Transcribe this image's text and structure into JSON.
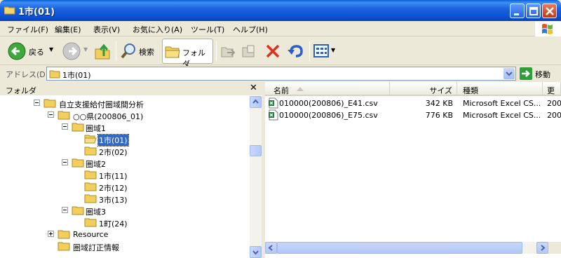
{
  "window": {
    "title": "1市(01)"
  },
  "menu": [
    "ファイル(F)",
    "編集(E)",
    "表示(V)",
    "お気に入り(A)",
    "ツール(T)",
    "ヘルプ(H)"
  ],
  "toolbar": {
    "back_label": "戻る",
    "search_label": "検索",
    "folders_label": "フォルダ"
  },
  "address": {
    "label": "アドレス(D)",
    "value": "1市(01)",
    "go_label": "移動"
  },
  "folder_pane": {
    "header": "フォルダ",
    "close_glyph": "✕",
    "tree": [
      {
        "label": "自立支援給付圏域間分析",
        "expander": "minus"
      },
      {
        "label": "○○県(200806_01)",
        "expander": "minus"
      },
      {
        "label": "圏域1",
        "expander": "minus"
      },
      {
        "label": "1市(01)",
        "expander": "none",
        "selected": true,
        "open": true
      },
      {
        "label": "2市(02)",
        "expander": "none"
      },
      {
        "label": "圏域2",
        "expander": "minus"
      },
      {
        "label": "1市(11)",
        "expander": "none"
      },
      {
        "label": "2市(12)",
        "expander": "none"
      },
      {
        "label": "3市(13)",
        "expander": "none"
      },
      {
        "label": "圏域3",
        "expander": "minus"
      },
      {
        "label": "1町(24)",
        "expander": "none"
      },
      {
        "label": "Resource",
        "expander": "plus"
      },
      {
        "label": "圏域訂正情報",
        "expander": "none"
      }
    ]
  },
  "file_list": {
    "columns": {
      "name": "名前",
      "size": "サイズ",
      "type": "種類",
      "modified": "更"
    },
    "rows": [
      {
        "name": "010000(200806)_E41.csv",
        "size": "342 KB",
        "type": "Microsoft Excel CS...",
        "modified": "200"
      },
      {
        "name": "010000(200806)_E75.csv",
        "size": "776 KB",
        "type": "Microsoft Excel CS...",
        "modified": "200"
      }
    ]
  },
  "colors": {
    "titlebar": "#0a4fd0",
    "selection": "#316ac5",
    "window_bg": "#ece9d8"
  }
}
